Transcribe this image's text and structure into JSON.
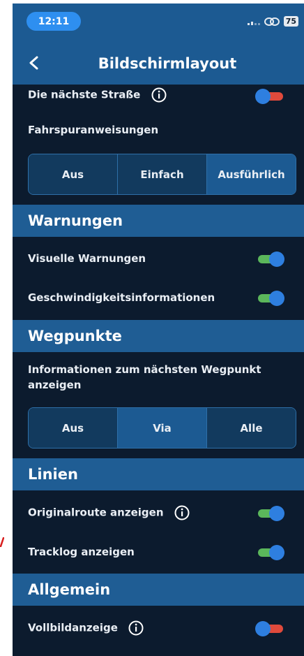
{
  "status": {
    "time": "12:11",
    "battery": "75"
  },
  "header": {
    "title": "Bildschirmlayout"
  },
  "rows": {
    "naechste_strasse": "Die nächste Straße",
    "fahrspur": "Fahrspuranweisungen",
    "visuelle": "Visuelle Warnungen",
    "geschw": "Geschwindigkeitsinformationen",
    "wegpunkt_info": "Informationen zum nächsten Wegpunkt anzeigen",
    "originalroute": "Originalroute anzeigen",
    "tracklog": "Tracklog anzeigen",
    "vollbild": "Vollbildanzeige"
  },
  "sections": {
    "warnungen": "Warnungen",
    "wegpunkte": "Wegpunkte",
    "linien": "Linien",
    "allgemein": "Allgemein"
  },
  "lane_options": [
    "Aus",
    "Einfach",
    "Ausführlich"
  ],
  "lane_selected": "Ausführlich",
  "waypoint_options": [
    "Aus",
    "Via",
    "Alle"
  ],
  "waypoint_selected": "Via",
  "toggles": {
    "naechste_strasse": false,
    "visuelle": true,
    "geschw": true,
    "originalroute": true,
    "tracklog": true,
    "vollbild": false
  },
  "colors": {
    "header": "#1c5a92",
    "background": "#0c1b2e",
    "toggle_on": "#5bb75b",
    "toggle_off": "#e04a3c",
    "knob": "#2e7fe0"
  }
}
